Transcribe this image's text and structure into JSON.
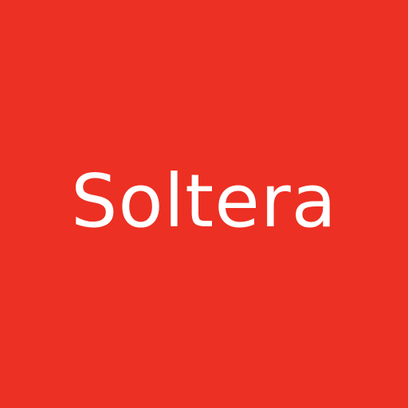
{
  "logo": {
    "wordmark": "Soltera",
    "background_color": "#ec3023",
    "text_color": "#ffffff"
  }
}
